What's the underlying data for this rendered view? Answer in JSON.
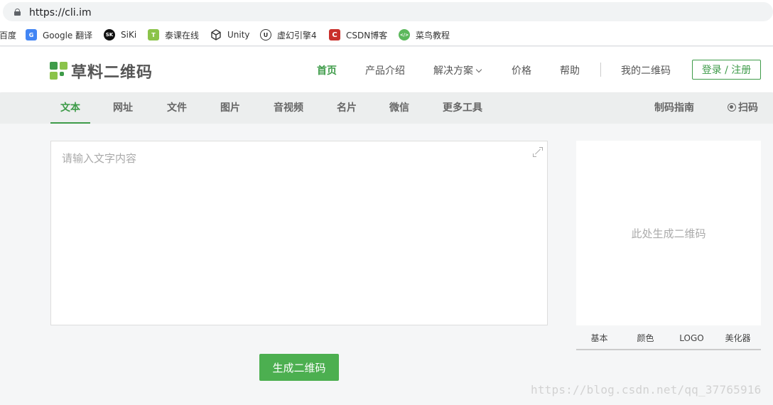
{
  "browser": {
    "url": "https://cli.im",
    "bookmarks": [
      {
        "label": "百度",
        "icon": "baidu-icon",
        "color": "#2932e1"
      },
      {
        "label": "Google 翻译",
        "icon": "google-translate-icon",
        "color": "#4285f4"
      },
      {
        "label": "SiKi",
        "icon": "siki-icon",
        "color": "#111111"
      },
      {
        "label": "泰课在线",
        "icon": "taikr-icon",
        "color": "#8bc34a"
      },
      {
        "label": "Unity",
        "icon": "unity-icon",
        "color": "#333333"
      },
      {
        "label": "虚幻引擎4",
        "icon": "unreal-icon",
        "color": "#333333"
      },
      {
        "label": "CSDN博客",
        "icon": "csdn-icon",
        "color": "#c9302c"
      },
      {
        "label": "菜鸟教程",
        "icon": "runoob-icon",
        "color": "#5cb85c"
      }
    ]
  },
  "header": {
    "logo_text": "草料二维码",
    "nav": [
      "首页",
      "产品介绍",
      "解决方案",
      "价格",
      "帮助",
      "我的二维码"
    ],
    "login_label": "登录 / 注册",
    "accent_color": "#3e9b49"
  },
  "tabs": {
    "items": [
      "文本",
      "网址",
      "文件",
      "图片",
      "音视频",
      "名片",
      "微信",
      "更多工具"
    ],
    "active": "文本",
    "guide": "制码指南",
    "scan": "扫码"
  },
  "editor": {
    "placeholder": "请输入文字内容",
    "generate_label": "生成二维码"
  },
  "qr": {
    "placeholder": "此处生成二维码",
    "tabs": [
      "基本",
      "颜色",
      "LOGO",
      "美化器"
    ]
  },
  "watermark": "https://blog.csdn.net/qq_37765916"
}
